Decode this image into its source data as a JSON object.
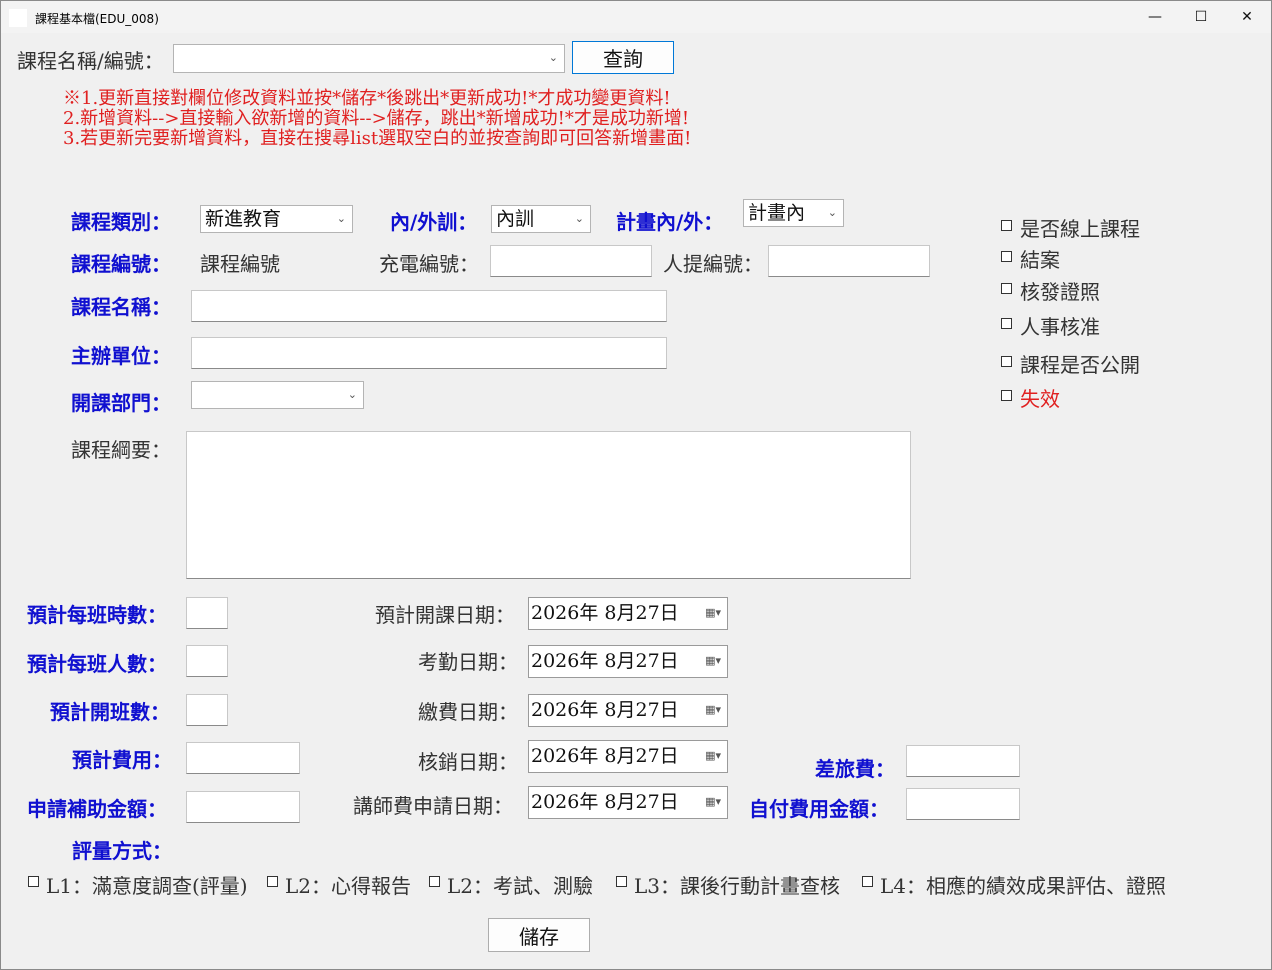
{
  "window": {
    "title": "課程基本檔(EDU_008)",
    "minimize": "—",
    "maximize": "☐",
    "close": "✕"
  },
  "search": {
    "label": "課程名稱/編號：",
    "value": "",
    "query_button": "查詢"
  },
  "notes": [
    "※1.更新直接對欄位修改資料並按*儲存*後跳出*更新成功!*才成功變更資料!",
    "2.新增資料-->直接輸入欲新增的資料-->儲存，跳出*新增成功!*才是成功新增!",
    "3.若更新完要新增資料，直接在搜尋list選取空白的並按查詢即可回答新增畫面!"
  ],
  "form": {
    "category_label": "課程類別：",
    "category_value": "新進教育",
    "inout_label": "內/外訓：",
    "inout_value": "內訓",
    "plan_label": "計畫內/外：",
    "plan_value": "計畫內",
    "course_no_label": "課程編號：",
    "course_no_value": "課程編號",
    "charge_no_label": "充電編號：",
    "hr_no_label": "人提編號：",
    "course_name_label": "課程名稱：",
    "host_label": "主辦單位：",
    "dept_label": "開課部門：",
    "dept_value": "",
    "outline_label": "課程綱要：",
    "hours_label": "預計每班時數：",
    "people_label": "預計每班人數：",
    "classes_label": "預計開班數：",
    "cost_label": "預計費用：",
    "subsidy_label": "申請補助金額：",
    "eval_label": "評量方式：",
    "start_date_label": "預計開課日期：",
    "attend_date_label": "考勤日期：",
    "pay_date_label": "繳費日期：",
    "writeoff_date_label": "核銷日期：",
    "lecturer_date_label": "講師費申請日期：",
    "travel_label": "差旅費：",
    "selfpay_label": "自付費用金額："
  },
  "dates": {
    "start": "2026年  8月27日",
    "attend": "2026年  8月27日",
    "pay": "2026年  8月27日",
    "writeoff": "2026年  8月27日",
    "lecturer": "2026年  8月27日"
  },
  "checkboxes": {
    "online": "是否線上課程",
    "closed": "結案",
    "certificate": "核發證照",
    "hr_approve": "人事核准",
    "public": "課程是否公開",
    "invalid": "失效"
  },
  "evaluation": {
    "l1": "L1：滿意度調查(評量)",
    "l2a": "L2：心得報告",
    "l2b": "L2：考試、測驗",
    "l3": "L3：課後行動計畫查核",
    "l4": "L4：相應的績效成果評估、證照"
  },
  "save_button": "儲存",
  "colors": {
    "label_blue": "#1010d0",
    "note_red": "#e02020",
    "background": "#f0f0f0"
  },
  "icons": {
    "dropdown": "chevron-down-icon",
    "calendar": "calendar-icon"
  }
}
